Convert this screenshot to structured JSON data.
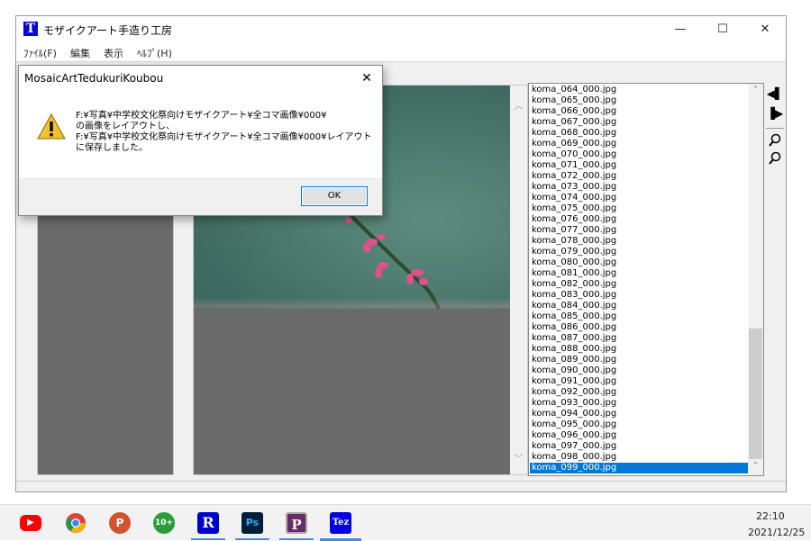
{
  "window": {
    "title": "モザイクアート手造り工房",
    "icon_letter": "T",
    "minimize": "—",
    "maximize": "☐",
    "close": "✕"
  },
  "menu": [
    "ﾌｧｲﾙ(F)",
    "編集",
    "表示",
    "ﾍﾙﾌﾟ(H)"
  ],
  "file_list": {
    "items": [
      "koma_064_000.jpg",
      "koma_065_000.jpg",
      "koma_066_000.jpg",
      "koma_067_000.jpg",
      "koma_068_000.jpg",
      "koma_069_000.jpg",
      "koma_070_000.jpg",
      "koma_071_000.jpg",
      "koma_072_000.jpg",
      "koma_073_000.jpg",
      "koma_074_000.jpg",
      "koma_075_000.jpg",
      "koma_076_000.jpg",
      "koma_077_000.jpg",
      "koma_078_000.jpg",
      "koma_079_000.jpg",
      "koma_080_000.jpg",
      "koma_081_000.jpg",
      "koma_082_000.jpg",
      "koma_083_000.jpg",
      "koma_084_000.jpg",
      "koma_085_000.jpg",
      "koma_086_000.jpg",
      "koma_087_000.jpg",
      "koma_088_000.jpg",
      "koma_089_000.jpg",
      "koma_090_000.jpg",
      "koma_091_000.jpg",
      "koma_092_000.jpg",
      "koma_093_000.jpg",
      "koma_094_000.jpg",
      "koma_095_000.jpg",
      "koma_096_000.jpg",
      "koma_097_000.jpg",
      "koma_098_000.jpg",
      "koma_099_000.jpg"
    ],
    "selected": "koma_099_000.jpg"
  },
  "dialog": {
    "title": "MosaicArtTedukuriKoubou",
    "close": "✕",
    "message_lines": [
      "F:¥写真¥中学校文化祭向けモザイクアート¥全コマ画像¥000¥",
      "の画像をレイアウトし、",
      "F:¥写真¥中学校文化祭向けモザイクアート¥全コマ画像¥000¥レイアウト",
      "に保存しました。"
    ],
    "ok_label": "OK"
  },
  "taskbar": {
    "apps": [
      {
        "name": "youtube",
        "glyph": "▶",
        "color": "#ff0000"
      },
      {
        "name": "chrome",
        "glyph": "",
        "color": "#4285f4"
      },
      {
        "name": "powerpoint",
        "glyph": "P",
        "color": "#d35230"
      },
      {
        "name": "10plus",
        "glyph": "10+",
        "color": "#2a9d3a"
      },
      {
        "name": "r-app",
        "glyph": "R",
        "color": "#0000cc"
      },
      {
        "name": "photoshop",
        "glyph": "Ps",
        "color": "#001e36"
      },
      {
        "name": "p-app",
        "glyph": "P",
        "color": "#6a2a6a"
      },
      {
        "name": "tez-app",
        "glyph": "Tez",
        "color": "#0000e0"
      }
    ],
    "time": "22:10",
    "date": "2021/12/25"
  }
}
